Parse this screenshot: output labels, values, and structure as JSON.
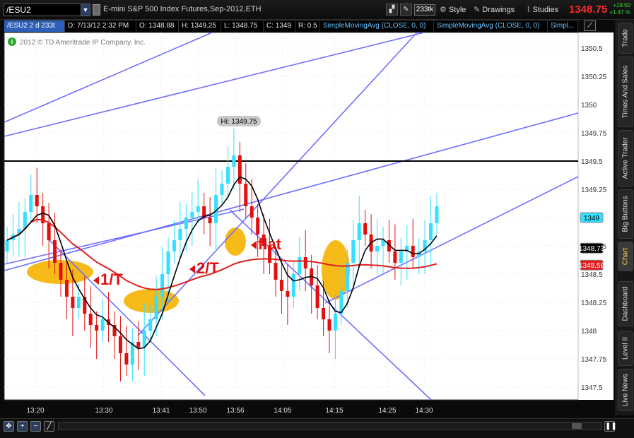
{
  "toolbar": {
    "symbol": "/ESU2",
    "symbol_dropdown_icon": "chevron-down-icon",
    "link_icon": "link-icon",
    "description": "E-mini S&P 500 Index Futures,Sep-2012,ETH",
    "aggregation": "233tk",
    "style_label": "Style",
    "drawings_label": "Drawings",
    "studies_label": "Studies",
    "last_price": "1348.75",
    "net_change": "+19.50",
    "net_change_pct": "+1.47 %"
  },
  "info_bar": {
    "symbol_period": "/ESU2 2 d 233t",
    "datetime": "D: 7/13/12 2:32 PM",
    "open": "O: 1348.88",
    "high": "H: 1349.25",
    "low": "L: 1348.75",
    "close": "C: 1349",
    "range": "R: 0.5",
    "study1": "SimpleMovingAvg (CLOSE, 0, 0)",
    "study2": "SimpleMovingAvg (CLOSE, 0, 0)",
    "study3": "Simpl..."
  },
  "right_tabs": [
    "Trade",
    "Times And Sales",
    "Active Trader",
    "Big Buttons",
    "Chart",
    "Dashboard",
    "Level II",
    "Live News"
  ],
  "active_tab": "Chart",
  "chart": {
    "copyright": "2012 © TD Ameritrade IP Company, Inc.",
    "hi_label": "Hi: 1349.75",
    "price_badges": [
      {
        "label": "1349",
        "value": 1349,
        "color": "#33e0ff",
        "text": "#000000"
      },
      {
        "label": "1348.73",
        "value": 1348.73,
        "color": "#000000",
        "text": "#ffffff"
      },
      {
        "label": "1348.58",
        "value": 1348.58,
        "color": "#e02020",
        "text": "#ffffff"
      }
    ],
    "annotations": [
      {
        "text": "1/T"
      },
      {
        "text": "2/T"
      },
      {
        "text": "flat"
      }
    ]
  },
  "colors": {
    "up_candle": "#33e0ff",
    "down_candle": "#e01010",
    "trendline": "#6f6fff",
    "sma_fast": "#000000",
    "sma_slow": "#e02020",
    "highlight": "#f5b400",
    "annotation": "#e01010"
  },
  "chart_data": {
    "type": "candlestick",
    "ylim": [
      1347.375,
      1350.625
    ],
    "ytick_labels": [
      "1350.5",
      "1350.25",
      "1350",
      "1349.75",
      "1349.5",
      "1349.25",
      "1349",
      "1348.75",
      "1348.5",
      "1348.25",
      "1348",
      "1347.75",
      "1347.5"
    ],
    "xtick_labels": [
      "13:20",
      "13:30",
      "13:41",
      "13:50",
      "13:56",
      "14:05",
      "14:15",
      "14:25",
      "14:30"
    ],
    "horizontal_line": 1349.5,
    "series": [
      {
        "name": "SimpleMovingAvg (CLOSE, 0, 0)",
        "color": "#000000"
      },
      {
        "name": "SimpleMovingAvg (CLOSE, 0, 0)",
        "color": "#e02020"
      }
    ]
  }
}
